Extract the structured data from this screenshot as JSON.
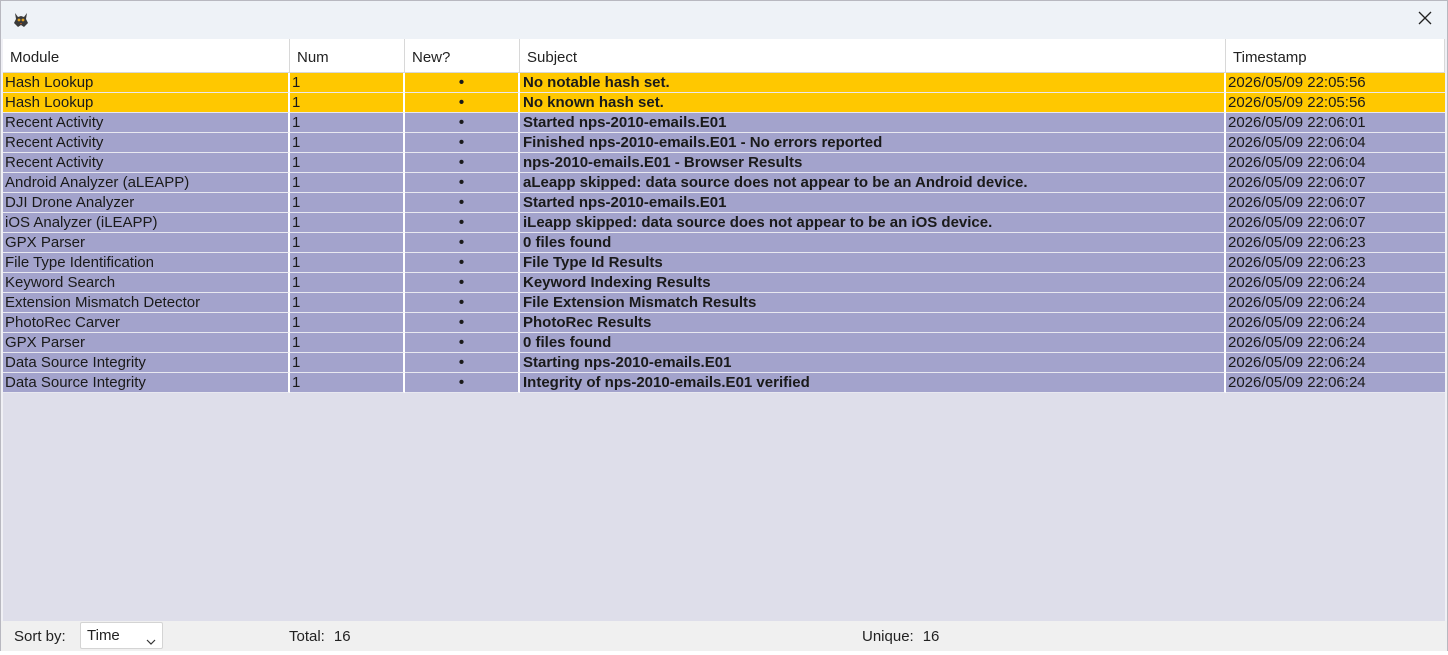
{
  "window": {
    "close_label": "✕"
  },
  "table": {
    "columns": [
      "Module",
      "Num",
      "New?",
      "Subject",
      "Timestamp"
    ],
    "rows": [
      {
        "module": "Hash Lookup",
        "num": "1",
        "new": "•",
        "subject": "No notable hash set.",
        "timestamp": "2026/05/09 22:05:56",
        "highlight": "notable"
      },
      {
        "module": "Hash Lookup",
        "num": "1",
        "new": "•",
        "subject": "No known hash set.",
        "timestamp": "2026/05/09 22:05:56",
        "highlight": "notable"
      },
      {
        "module": "Recent Activity",
        "num": "1",
        "new": "•",
        "subject": "Started nps-2010-emails.E01",
        "timestamp": "2026/05/09 22:06:01",
        "highlight": "normal"
      },
      {
        "module": "Recent Activity",
        "num": "1",
        "new": "•",
        "subject": "Finished nps-2010-emails.E01 - No errors reported",
        "timestamp": "2026/05/09 22:06:04",
        "highlight": "normal"
      },
      {
        "module": "Recent Activity",
        "num": "1",
        "new": "•",
        "subject": "nps-2010-emails.E01 - Browser Results",
        "timestamp": "2026/05/09 22:06:04",
        "highlight": "normal"
      },
      {
        "module": "Android Analyzer (aLEAPP)",
        "num": "1",
        "new": "•",
        "subject": "aLeapp skipped: data source does not appear to be an Android device.",
        "timestamp": "2026/05/09 22:06:07",
        "highlight": "normal"
      },
      {
        "module": "DJI Drone Analyzer",
        "num": "1",
        "new": "•",
        "subject": "Started nps-2010-emails.E01",
        "timestamp": "2026/05/09 22:06:07",
        "highlight": "normal"
      },
      {
        "module": "iOS Analyzer (iLEAPP)",
        "num": "1",
        "new": "•",
        "subject": "iLeapp skipped: data source does not appear to be an iOS device.",
        "timestamp": "2026/05/09 22:06:07",
        "highlight": "normal"
      },
      {
        "module": "GPX Parser",
        "num": "1",
        "new": "•",
        "subject": "0 files found",
        "timestamp": "2026/05/09 22:06:23",
        "highlight": "normal"
      },
      {
        "module": "File Type Identification",
        "num": "1",
        "new": "•",
        "subject": "File Type Id Results",
        "timestamp": "2026/05/09 22:06:23",
        "highlight": "normal"
      },
      {
        "module": "Keyword Search",
        "num": "1",
        "new": "•",
        "subject": "Keyword Indexing Results",
        "timestamp": "2026/05/09 22:06:24",
        "highlight": "normal"
      },
      {
        "module": "Extension Mismatch Detector",
        "num": "1",
        "new": "•",
        "subject": "File Extension Mismatch Results",
        "timestamp": "2026/05/09 22:06:24",
        "highlight": "normal"
      },
      {
        "module": "PhotoRec Carver",
        "num": "1",
        "new": "•",
        "subject": "PhotoRec Results",
        "timestamp": "2026/05/09 22:06:24",
        "highlight": "normal"
      },
      {
        "module": "GPX Parser",
        "num": "1",
        "new": "•",
        "subject": "0 files found",
        "timestamp": "2026/05/09 22:06:24",
        "highlight": "normal"
      },
      {
        "module": "Data Source Integrity",
        "num": "1",
        "new": "•",
        "subject": "Starting nps-2010-emails.E01",
        "timestamp": "2026/05/09 22:06:24",
        "highlight": "normal"
      },
      {
        "module": "Data Source Integrity",
        "num": "1",
        "new": "•",
        "subject": "Integrity of nps-2010-emails.E01 verified",
        "timestamp": "2026/05/09 22:06:24",
        "highlight": "normal"
      }
    ]
  },
  "status": {
    "sort_label": "Sort by:",
    "sort_value": "Time",
    "total_label": "Total:",
    "total_value": "16",
    "unique_label": "Unique:",
    "unique_value": "16"
  },
  "colors": {
    "notable_row": "#ffc800",
    "normal_row": "#a3a3cc",
    "empty_area": "#dedeea"
  },
  "icons": [
    "autopsy-app-icon",
    "close-icon",
    "chevron-down-icon"
  ]
}
